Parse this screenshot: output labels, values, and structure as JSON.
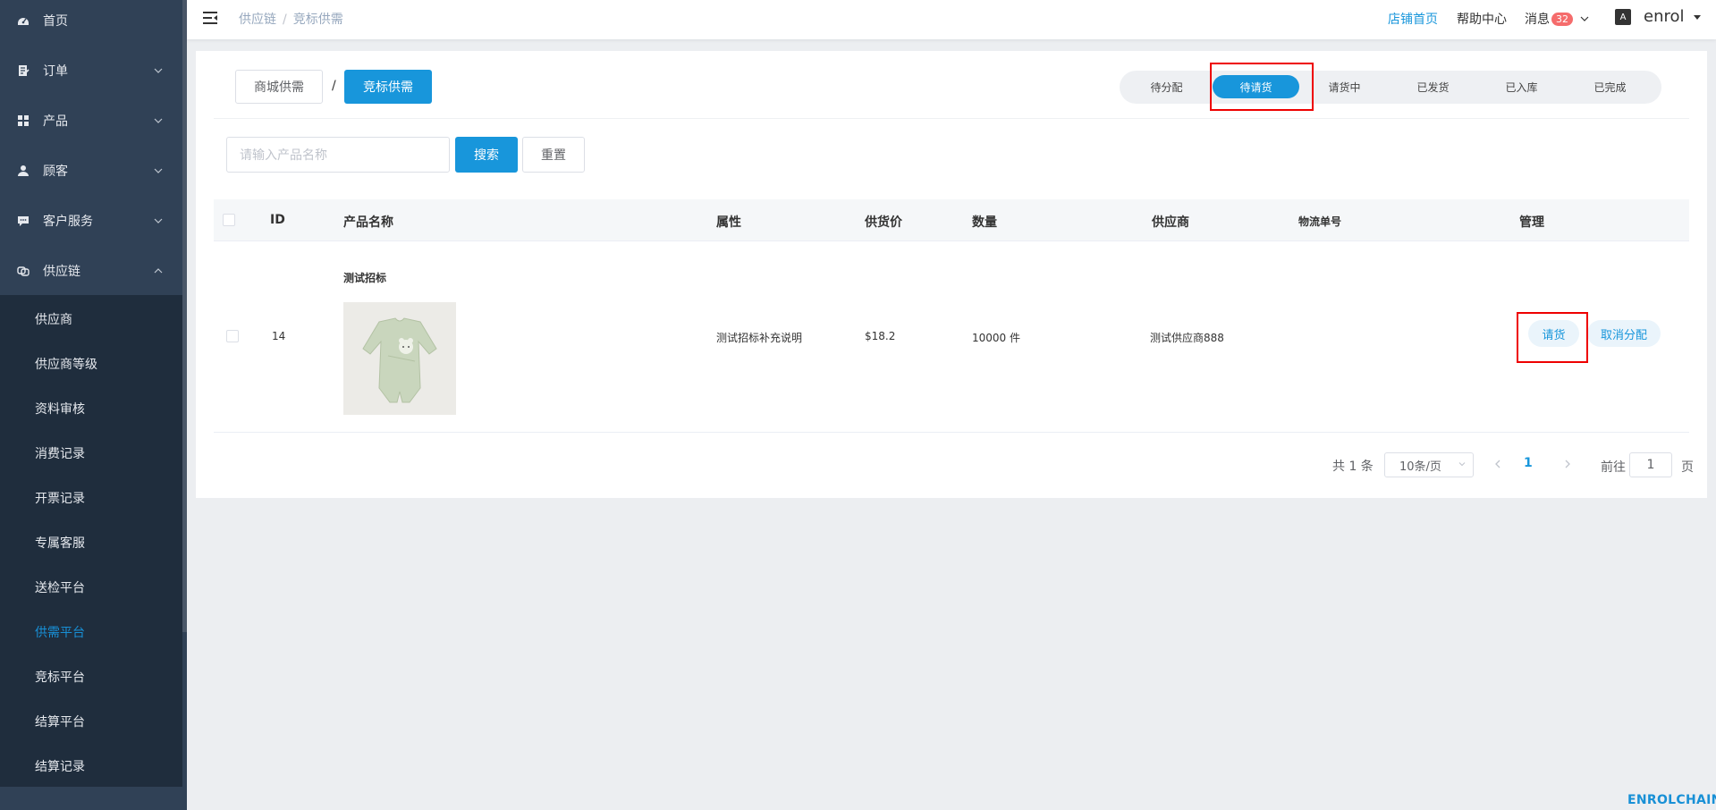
{
  "sidebar": {
    "items": [
      {
        "label": "首页",
        "icon": "dashboard-icon"
      },
      {
        "label": "订单",
        "icon": "order-icon"
      },
      {
        "label": "产品",
        "icon": "grid-icon"
      },
      {
        "label": "顾客",
        "icon": "user-icon"
      },
      {
        "label": "客户服务",
        "icon": "chat-icon"
      },
      {
        "label": "供应链",
        "icon": "supply-chain-icon"
      }
    ],
    "sub_items": [
      "供应商",
      "供应商等级",
      "资料审核",
      "消费记录",
      "开票记录",
      "专属客服",
      "送检平台",
      "供需平台",
      "竞标平台",
      "结算平台",
      "结算记录"
    ],
    "active_sub": "供需平台",
    "active_color": "#1890d6"
  },
  "header": {
    "breadcrumb": [
      "供应链",
      "竞标供需"
    ],
    "store_home": "店铺首页",
    "help": "帮助中心",
    "messages": "消息",
    "message_count": "32",
    "lang_icon": "A",
    "username": "enrol"
  },
  "main": {
    "type_tabs": [
      "商城供需",
      "竞标供需"
    ],
    "type_separator": "/",
    "status_tabs": [
      "待分配",
      "待请货",
      "请货中",
      "已发货",
      "已入库",
      "已完成"
    ],
    "active_status": "待请货",
    "search": {
      "placeholder": "请输入产品名称",
      "search_label": "搜索",
      "reset_label": "重置"
    },
    "table": {
      "columns": [
        "ID",
        "产品名称",
        "属性",
        "供货价",
        "数量",
        "供应商",
        "物流单号",
        "管理"
      ],
      "rows": [
        {
          "id": "14",
          "product_name": "测试招标",
          "attribute": "测试招标补充说明",
          "price": "$18.2",
          "quantity": "10000 件",
          "supplier": "测试供应商888",
          "tracking": "",
          "actions": [
            "请货",
            "取消分配"
          ]
        }
      ]
    },
    "pagination": {
      "total_text": "共 1 条",
      "page_size": "10条/页",
      "current_page": "1",
      "goto_prefix": "前往",
      "goto_value": "1",
      "goto_suffix": "页"
    }
  },
  "watermark": "ENROLCHAIN",
  "colors": {
    "primary": "#1896db",
    "sidebar": "#304156",
    "submenu": "#1f2d3d",
    "highlight": "#e00000",
    "badge": "#f56c6c"
  }
}
